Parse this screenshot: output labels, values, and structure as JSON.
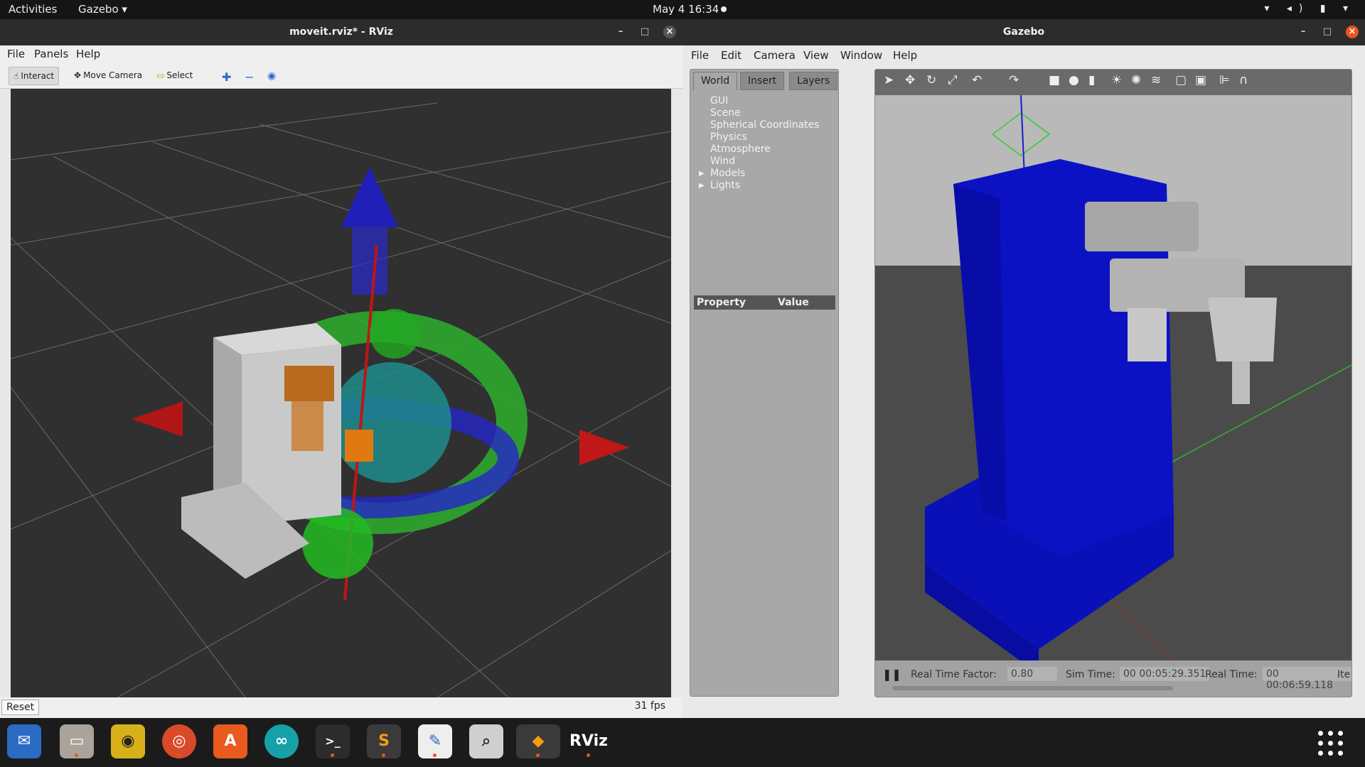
{
  "topbar": {
    "activities": "Activities",
    "app_name": "Gazebo ▾",
    "clock": "May 4  16:34",
    "tray": "▾ ◂) ▮ ▾"
  },
  "rviz": {
    "title": "moveit.rviz* - RViz",
    "menu": [
      "File",
      "Panels",
      "Help"
    ],
    "tools": {
      "interact": "Interact",
      "move_camera": "Move Camera",
      "select": "Select"
    },
    "reset": "Reset",
    "fps": "31 fps"
  },
  "gazebo": {
    "title": "Gazebo",
    "menu": [
      "File",
      "Edit",
      "Camera",
      "View",
      "Window",
      "Help"
    ],
    "tabs": [
      "World",
      "Insert",
      "Layers"
    ],
    "tree": [
      "GUI",
      "Scene",
      "Spherical Coordinates",
      "Physics",
      "Atmosphere",
      "Wind",
      "Models",
      "Lights"
    ],
    "property_header": "Property",
    "value_header": "Value",
    "real_time_factor_label": "Real Time Factor:",
    "real_time_factor": "0.80",
    "sim_time_label": "Sim Time:",
    "sim_time": "00 00:05:29.351",
    "real_time_label": "Real Time:",
    "real_time": "00 00:06:59.118",
    "iterations_label": "Ite"
  },
  "dock": {
    "items": [
      "thunderbird",
      "files",
      "rhythmbox",
      "chrome",
      "software",
      "arduino",
      "terminal",
      "sublime",
      "text-editor",
      "image-viewer",
      "gazebo",
      "rviz"
    ],
    "rviz_label": "RViz"
  },
  "colors": {
    "accent": "#e95420",
    "gazebo_model": "#0a10b8",
    "viewport_bg": "#303030"
  }
}
